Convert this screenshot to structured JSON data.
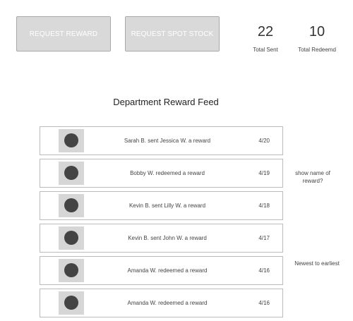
{
  "header": {
    "request_reward_label": "REQUEST REWARD",
    "request_spot_stock_label": "REQUEST SPOT STOCK"
  },
  "stats": {
    "total_sent": {
      "value": "22",
      "label": "Total Sent"
    },
    "total_redeemed": {
      "value": "10",
      "label": "Total Redeemd"
    }
  },
  "feed": {
    "title": "Department Reward Feed",
    "items": [
      {
        "message": "Sarah B. sent Jessica W. a reward",
        "date": "4/20"
      },
      {
        "message": "Bobby W. redeemed a reward",
        "date": "4/19"
      },
      {
        "message": "Kevin B. sent Lilly W. a reward",
        "date": "4/18"
      },
      {
        "message": "Kevin B. sent John W. a reward",
        "date": "4/17"
      },
      {
        "message": "Amanda W. redeemed a reward",
        "date": "4/16"
      },
      {
        "message": "Amanda W. redeemed a reward",
        "date": "4/16"
      }
    ]
  },
  "notes": {
    "show_name_line1": "show name of",
    "show_name_line2": "reward?",
    "order": "Newest to earliest"
  }
}
